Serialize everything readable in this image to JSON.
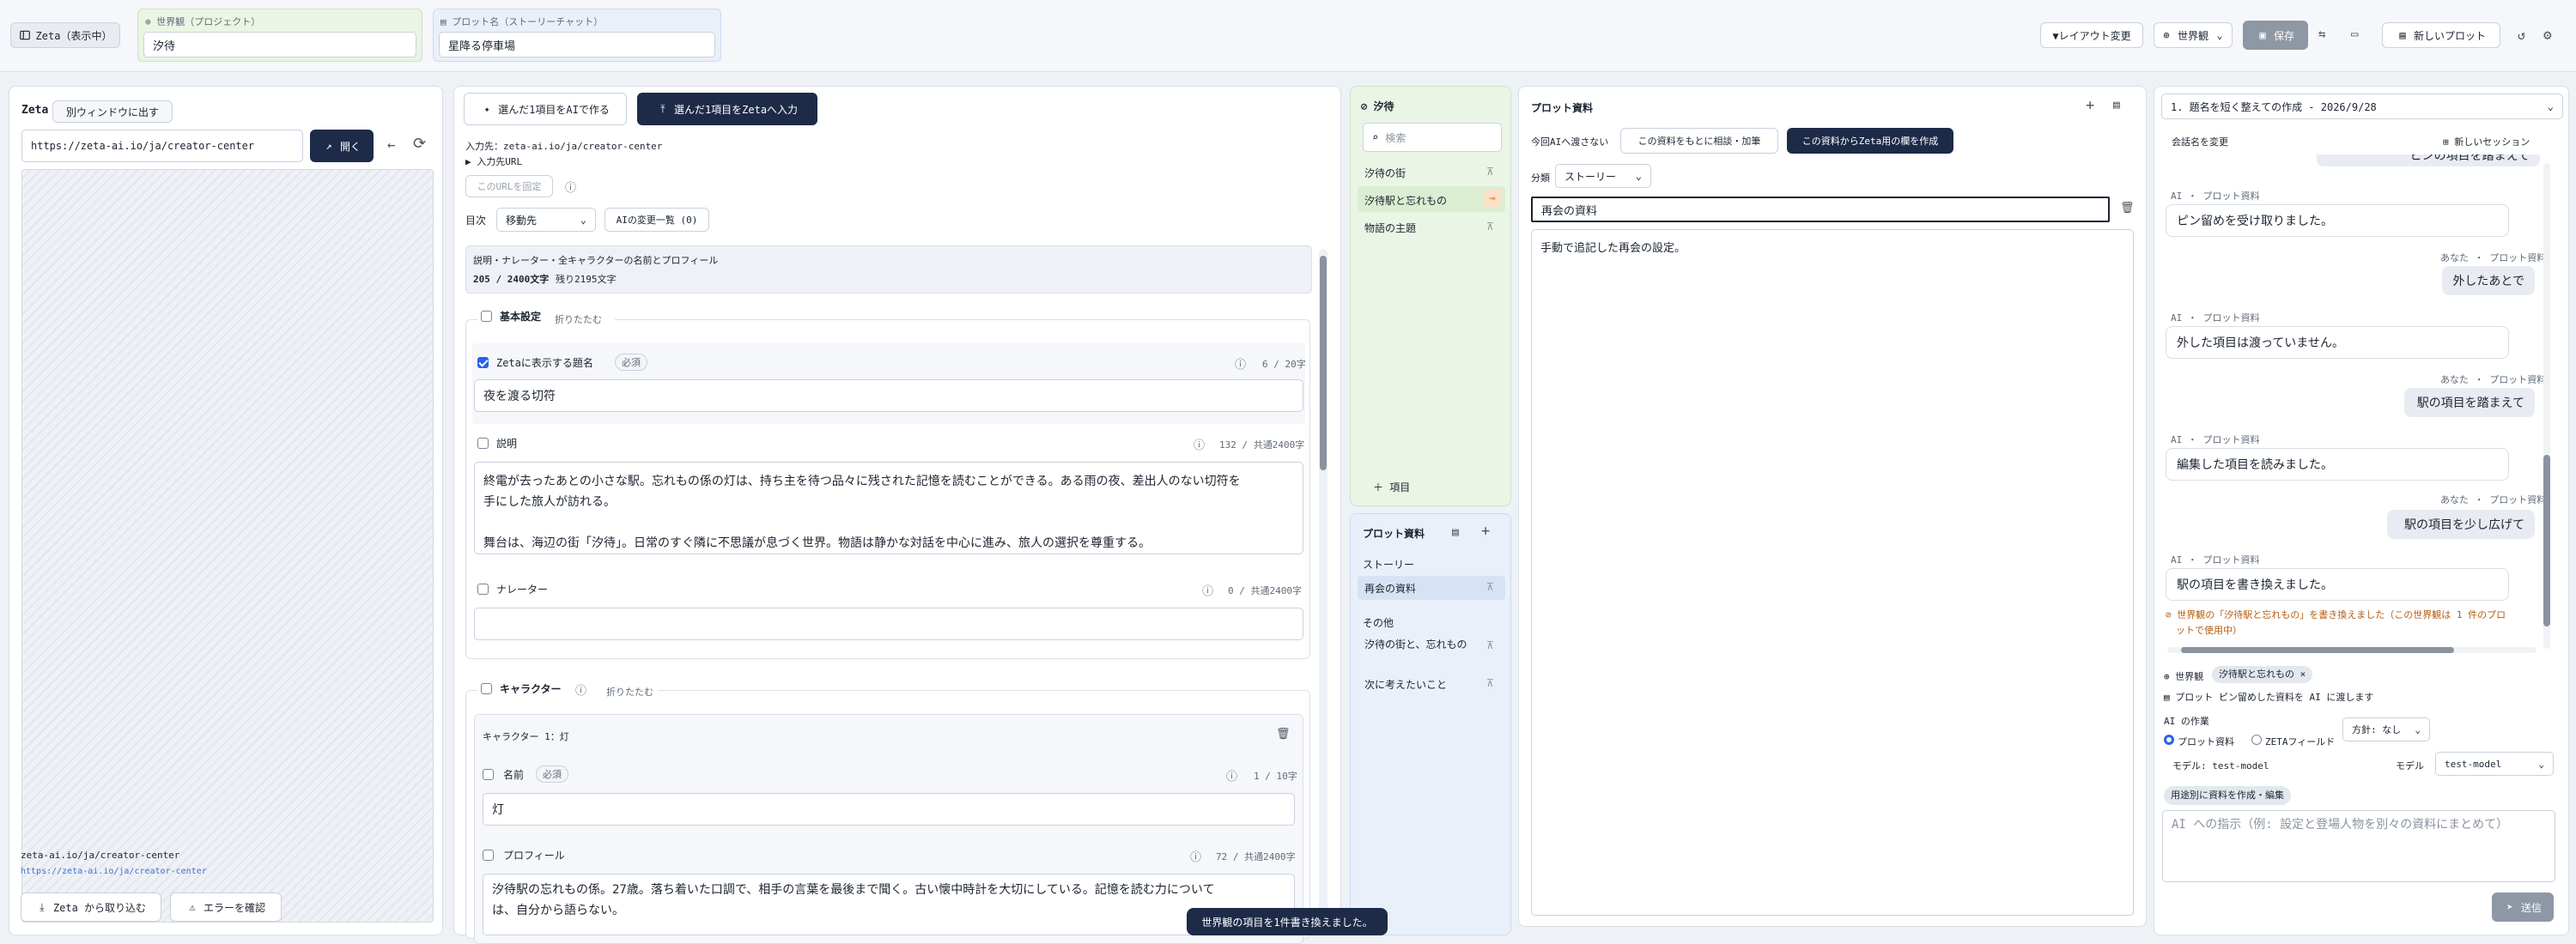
{
  "topbar": {
    "zeta_mode": "Zeta（表示中）",
    "world_label": "世界観（プロジェクト）",
    "world_value": "汐待",
    "plot_label": "プロット名（ストーリーチャット）",
    "plot_value": "星降る停車場",
    "layout_btn": "▼レイアウト変更",
    "world_btn": "世界観",
    "save_btn": "保存",
    "new_plot_btn": "新しいプロット"
  },
  "browser": {
    "title": "Zeta",
    "popout_btn": "別ウィンドウに出す",
    "url": "https://zeta-ai.io/ja/creator-center",
    "open_btn": "開く",
    "footer_host": "zeta-ai.io/ja/creator-center",
    "footer_url": "https://zeta-ai.io/ja/creator-center",
    "import_btn": "Zeta から取り込む",
    "error_btn": "エラーを確認"
  },
  "editor": {
    "ai_make_btn": "選んだ1項目をAIで作る",
    "zeta_input_btn": "選んだ1項目をZetaへ入力",
    "input_dest": "入力先：zeta-ai.io/ja/creator-center",
    "input_url_toggle": "▶ 入力先URL",
    "fix_url_btn": "このURLを固定",
    "toc_label": "目次",
    "toc_select": "移動先",
    "ai_changes_btn": "AIの変更一覧 (0)",
    "summary_desc": "説明・ナレーター・全キャラクターの名前とプロフィール",
    "summary_count": "205 / 2400文字",
    "summary_remaining": "残り2195文字",
    "basic_title": "基本設定",
    "collapse": "折りたたむ",
    "title_label": "Zetaに表示する題名",
    "required": "必須",
    "title_count": "6 / 20字",
    "title_value": "夜を渡る切符",
    "desc_label": "説明",
    "desc_count": "132 / 共通2400字",
    "desc_line1": "終電が去ったあとの小さな駅。忘れもの係の灯は、持ち主を待つ品々に残された記憶を読むことができる。ある雨の夜、差出人のない切符を",
    "desc_line2": "手にした旅人が訪れる。",
    "desc_line3": "舞台は、海辺の街「汐待」。日常のすぐ隣に不思議が息づく世界。物語は静かな対話を中心に進み、旅人の選択を尊重する。",
    "narrator_label": "ナレーター",
    "narrator_count": "0 / 共通2400字",
    "char_section": "キャラクター",
    "char1_title": "キャラクター 1：灯",
    "name_label": "名前",
    "name_count": "1 / 10字",
    "name_value": "灯",
    "profile_label": "プロフィール",
    "profile_count": "72 / 共通2400字",
    "profile_line1": "汐待駅の忘れもの係。27歳。落ち着いた口調で、相手の言葉を最後まで聞く。古い懐中時計を大切にしている。記憶を読む力について",
    "profile_line2": "は、自分から語らない。"
  },
  "world_list": {
    "title": "汐待",
    "search_placeholder": "検索",
    "items": [
      "汐待の街",
      "汐待駅と忘れもの",
      "物語の主題"
    ],
    "add_item": "＋ 項目"
  },
  "plot_list": {
    "title": "プロット資料",
    "group_story": "ストーリー",
    "story_items": [
      "再会の資料"
    ],
    "group_other": "その他",
    "other_items": [
      "汐待の街と、忘れもの",
      "次に考えたいこと"
    ]
  },
  "plot_doc": {
    "title": "プロット資料",
    "not_to_ai": "今回AIへ渡さない",
    "consult_btn": "この資料をもとに相談・加筆",
    "create_btn": "この資料からZeta用の欄を作成",
    "category_label": "分類",
    "category_value": "ストーリー",
    "doc_title": "再会の資料",
    "doc_body": "手動で追記した再会の設定。"
  },
  "chat": {
    "session": "1. 題名を短く整えての作成 - 2026/9/28",
    "rename": "会話名を変更",
    "new_session": "新しいセッション",
    "top_cut": "ピンの項目を踏まえて",
    "messages": [
      {
        "who": "ai",
        "meta": "AI ・ プロット資料",
        "text": "ピン留めを受け取りました。"
      },
      {
        "who": "me",
        "meta": "あなた ・ プロット資料",
        "text": "外したあとで"
      },
      {
        "who": "ai",
        "meta": "AI ・ プロット資料",
        "text": "外した項目は渡っていません。"
      },
      {
        "who": "me",
        "meta": "あなた ・ プロット資料",
        "text": "駅の項目を踏まえて"
      },
      {
        "who": "ai",
        "meta": "AI ・ プロット資料",
        "text": "編集した項目を読みました。"
      },
      {
        "who": "me",
        "meta": "あなた ・ プロット資料",
        "text": "駅の項目を少し広げて"
      },
      {
        "who": "ai",
        "meta": "AI ・ プロット資料",
        "text": "駅の項目を書き換えました。"
      }
    ],
    "notice_line1": "世界観の「汐待駅と忘れもの」を書き換えました（この世界観は 1 件のプロ",
    "notice_line2": "ットで使用中）",
    "world_chip_label": "世界観",
    "world_chip": "汐待駅と忘れもの",
    "pin_note": "プロット ピン留めした資料を AI に渡します",
    "ai_work": "AI の作業",
    "radio_plot": "プロット資料",
    "radio_zeta": "ZETAフィールド",
    "policy": "方針: なし",
    "model_note": "モデル: test-model",
    "model_label": "モデル",
    "model_value": "test-model",
    "purpose_chip": "用途別に資料を作成・編集",
    "input_placeholder": "AI への指示（例: 設定と登場人物を別々の資料にまとめて）",
    "send_btn": "送信"
  },
  "toast": "世界観の項目を1件書き換えました。",
  "colors": {
    "dark": "#1d2b48",
    "accent_green": "#e9f5e4",
    "accent_blue": "#e8f0fb",
    "pin_orange": "#e07a1f"
  }
}
